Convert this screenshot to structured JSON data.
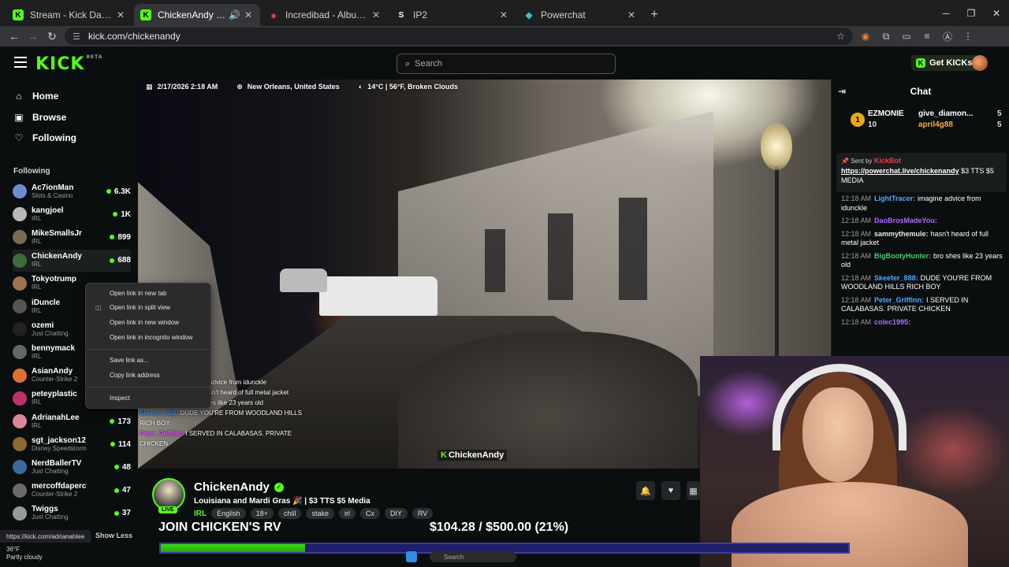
{
  "browser": {
    "tabs": [
      {
        "title": "Stream - Kick Dashboard",
        "favicon": "K",
        "color": "#53fc18",
        "active": false
      },
      {
        "title": "ChickenAndy Stream - Watch",
        "favicon": "K",
        "color": "#53fc18",
        "active": true
      },
      {
        "title": "Incredibad - Album by The Lonely Island",
        "favicon": "●",
        "color": "#e8354a",
        "active": false
      },
      {
        "title": "IP2",
        "favicon": "S",
        "color": "#ffffff",
        "active": false
      },
      {
        "title": "Powerchat",
        "favicon": "◆",
        "color": "#2ec4c4",
        "active": false
      }
    ],
    "url": "kick.com/chickenandy",
    "status_url": "https://kick.com/adrianahlee"
  },
  "header": {
    "logo": "KICK",
    "logo_badge": "BETA",
    "search_placeholder": "Search",
    "get_kicks": "Get KICKs"
  },
  "sidebar": {
    "nav": [
      {
        "label": "Home",
        "icon": "home-icon"
      },
      {
        "label": "Browse",
        "icon": "browse-icon"
      },
      {
        "label": "Following",
        "icon": "heart-icon"
      }
    ],
    "following_heading": "Following",
    "following": [
      {
        "name": "Ac7ionMan",
        "category": "Slots & Casino",
        "viewers": "6.3K",
        "color": "#6a8fd1"
      },
      {
        "name": "kangjoel",
        "category": "IRL",
        "viewers": "1K",
        "color": "#b9b9b9"
      },
      {
        "name": "MikeSmallsJr",
        "category": "IRL",
        "viewers": "899",
        "color": "#7a6a55"
      },
      {
        "name": "ChickenAndy",
        "category": "IRL",
        "viewers": "688",
        "color": "#3e6b3e"
      },
      {
        "name": "Tokyotrump",
        "category": "IRL",
        "viewers": "",
        "color": "#a07050"
      },
      {
        "name": "iDuncle",
        "category": "IRL",
        "viewers": "",
        "color": "#555"
      },
      {
        "name": "ozemi",
        "category": "Just Chatting",
        "viewers": "",
        "color": "#222"
      },
      {
        "name": "bennymack",
        "category": "IRL",
        "viewers": "",
        "color": "#666"
      },
      {
        "name": "AsianAndy",
        "category": "Counter-Strike 2",
        "viewers": "",
        "color": "#e07030"
      },
      {
        "name": "peteyplastic",
        "category": "IRL",
        "viewers": "",
        "color": "#c0306a"
      },
      {
        "name": "AdrianahLee",
        "category": "IRL",
        "viewers": "173",
        "color": "#d9889a"
      },
      {
        "name": "sgt_jackson12",
        "category": "Disney Speedstorm",
        "viewers": "114",
        "color": "#8a6a30"
      },
      {
        "name": "NerdBallerTV",
        "category": "Just Chatting",
        "viewers": "48",
        "color": "#3a6a9a"
      },
      {
        "name": "mercoffdaperc",
        "category": "Counter-Strike 2",
        "viewers": "47",
        "color": "#6a6a6a"
      },
      {
        "name": "Twiggs",
        "category": "Just Chatting",
        "viewers": "37",
        "color": "#999"
      }
    ],
    "show_less": "Show Less"
  },
  "context_menu": {
    "items": [
      "Open link in new tab",
      "Open link in split view",
      "Open link in new window",
      "Open link in incognito window",
      "Save link as...",
      "Copy link address",
      "Inspect"
    ]
  },
  "video": {
    "datetime": "2/17/2026 2:18 AM",
    "location": "New Orleans, United States",
    "weather": "14°C | 56°F, Broken Clouds",
    "watermark_k": "K",
    "watermark_name": "ChickenAndy",
    "overlay_chat": [
      {
        "user": "",
        "text": "advice from idunckle",
        "color": "#fff"
      },
      {
        "user": "",
        "text": "sn't heard of full metal jacket",
        "color": "#fff"
      },
      {
        "user": "BigBootyHunter:",
        "text": "bro shes like 23 years old",
        "color": "#3fd16b"
      },
      {
        "user": "Skeeter_888:",
        "text": "DUDE YOU'RE FROM WOODLAND HILLS RICH BOY",
        "color": "#53a7ff"
      },
      {
        "user": "Peter_Griffinn:",
        "text": "I SERVED IN CALABASAS. PRIVATE CHICKEN",
        "color": "#e056fd"
      }
    ]
  },
  "stream": {
    "name": "ChickenAndy",
    "live": "LIVE",
    "title": "Louisiana and Mardi Gras 🎉 | $3 TTS $5 Media",
    "category": "IRL",
    "tags": [
      "English",
      "18+",
      "chill",
      "stake",
      "irl",
      "Cx",
      "DIY",
      "RV"
    ]
  },
  "goal": {
    "text": "JOIN CHICKEN'S RV",
    "amount": "$104.28 / $500.00 (21%)",
    "progress": 0.21
  },
  "taskbar": {
    "temp": "36°F",
    "condition": "Partly cloudy",
    "search": "Search"
  },
  "chat": {
    "title": "Chat",
    "leaderboard": [
      {
        "rank": "1",
        "user": "EZMONIE",
        "count": "10"
      },
      {
        "user": "give_diamon...",
        "count": "5"
      },
      {
        "user": "april4g88",
        "count": "5"
      }
    ],
    "pinned": {
      "sent_by": "Sent by",
      "sender": "KickBot",
      "link": "https://powerchat.live/chickenandy",
      "text": "$3 TTS $5 MEDIA"
    },
    "messages": [
      {
        "time": "12:18 AM",
        "user": "LightTracer:",
        "color": "#53a7ff",
        "text": "imagine advice from idunckle"
      },
      {
        "time": "12:18 AM",
        "user": "DaoBrosMadeYou:",
        "color": "#b06bff",
        "text": ""
      },
      {
        "time": "12:18 AM",
        "user": "sammythemule:",
        "color": "#e8e8e8",
        "text": "hasn't heard of full metal jacket"
      },
      {
        "time": "12:18 AM",
        "user": "BigBootyHunter:",
        "color": "#3fd16b",
        "text": "bro shes like 23 years old"
      },
      {
        "time": "12:18 AM",
        "user": "Skeeter_888:",
        "color": "#53a7ff",
        "text": "DUDE YOU'RE FROM WOODLAND HILLS RICH BOY"
      },
      {
        "time": "12:18 AM",
        "user": "Peter_Griffinn:",
        "color": "#53a7ff",
        "text": "I SERVED IN CALABASAS. PRIVATE CHICKEN"
      },
      {
        "time": "12:18 AM",
        "user": "colec1995:",
        "color": "#b06bff",
        "text": ""
      }
    ]
  }
}
